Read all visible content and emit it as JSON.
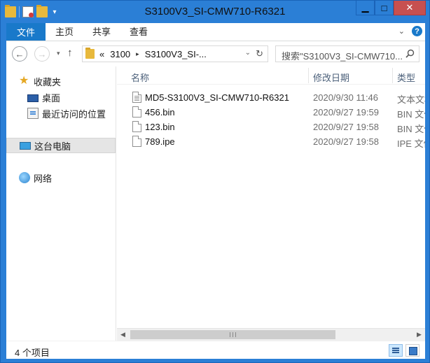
{
  "window": {
    "title": "S3100V3_SI-CMW710-R6321",
    "minimize_glyph": "▁",
    "maximize_glyph": "□",
    "close_glyph": "✕"
  },
  "quick_access": {
    "dropdown_glyph": "▾"
  },
  "ribbon": {
    "file_tab": "文件",
    "tabs": [
      "主页",
      "共享",
      "查看"
    ],
    "expand_glyph": "⌄",
    "help_glyph": "?"
  },
  "nav": {
    "back_glyph": "←",
    "forward_glyph": "→",
    "recent_glyph": "▾",
    "up_glyph": "↑",
    "breadcrumb": {
      "overflow": "«",
      "items": [
        "3100",
        "S3100V3_SI-..."
      ],
      "separator": "▸"
    },
    "addr_dropdown_glyph": "⌄",
    "refresh_glyph": "↻",
    "search_placeholder": "搜索\"S3100V3_SI-CMW710..."
  },
  "sidebar": {
    "items": [
      {
        "label": "收藏夹",
        "icon": "star-icon"
      },
      {
        "label": "桌面",
        "icon": "desktop-icon"
      },
      {
        "label": "最近访问的位置",
        "icon": "recent-places-icon"
      },
      {
        "label": "这台电脑",
        "icon": "computer-icon",
        "selected": true
      },
      {
        "label": "网络",
        "icon": "network-icon"
      }
    ]
  },
  "filelist": {
    "columns": [
      "名称",
      "修改日期",
      "类型"
    ],
    "rows": [
      {
        "name": "MD5-S3100V3_SI-CMW710-R6321",
        "date": "2020/9/30 11:46",
        "type": "文本文档",
        "icon": "text-file-icon"
      },
      {
        "name": "456.bin",
        "date": "2020/9/27 19:59",
        "type": "BIN 文件",
        "icon": "file-icon"
      },
      {
        "name": "123.bin",
        "date": "2020/9/27 19:58",
        "type": "BIN 文件",
        "icon": "file-icon"
      },
      {
        "name": "789.ipe",
        "date": "2020/9/27 19:58",
        "type": "IPE 文件",
        "icon": "file-icon"
      }
    ]
  },
  "scrollbar": {
    "left_glyph": "◀",
    "right_glyph": "▶"
  },
  "status": {
    "item_count": "4 个项目"
  }
}
